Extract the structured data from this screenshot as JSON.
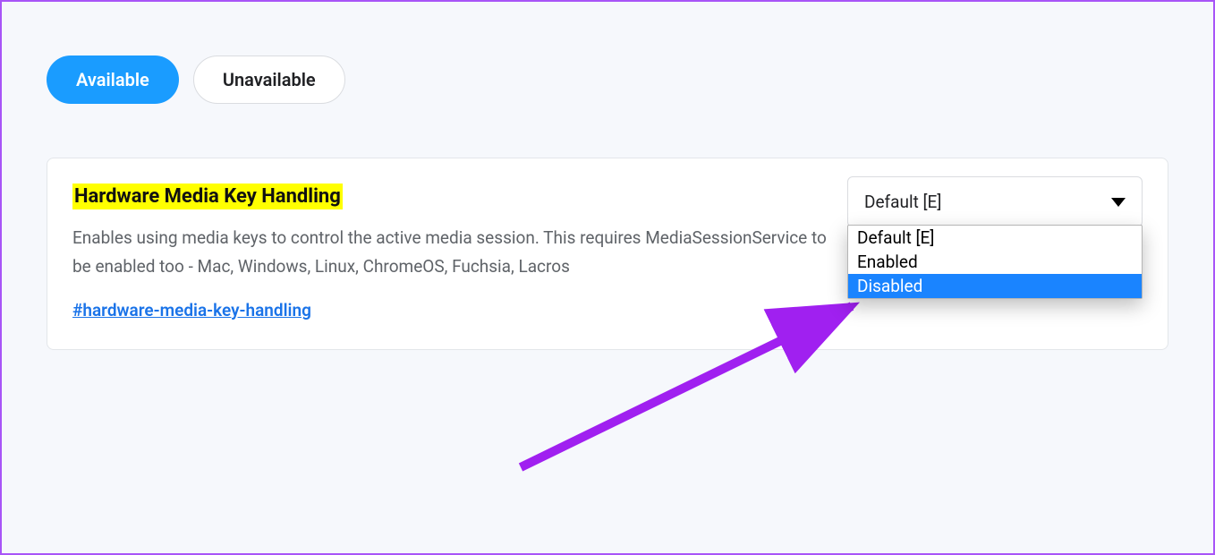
{
  "tabs": {
    "available": "Available",
    "unavailable": "Unavailable"
  },
  "flag": {
    "title": "Hardware Media Key Handling",
    "description": "Enables using media keys to control the active media session. This requires MediaSessionService to be enabled too - Mac, Windows, Linux, ChromeOS, Fuchsia, Lacros",
    "anchor": "#hardware-media-key-handling"
  },
  "dropdown": {
    "selected": "Default [E]",
    "options": {
      "default": "Default [E]",
      "enabled": "Enabled",
      "disabled": "Disabled"
    }
  },
  "annotation": {
    "arrow_color": "#a020f0"
  }
}
